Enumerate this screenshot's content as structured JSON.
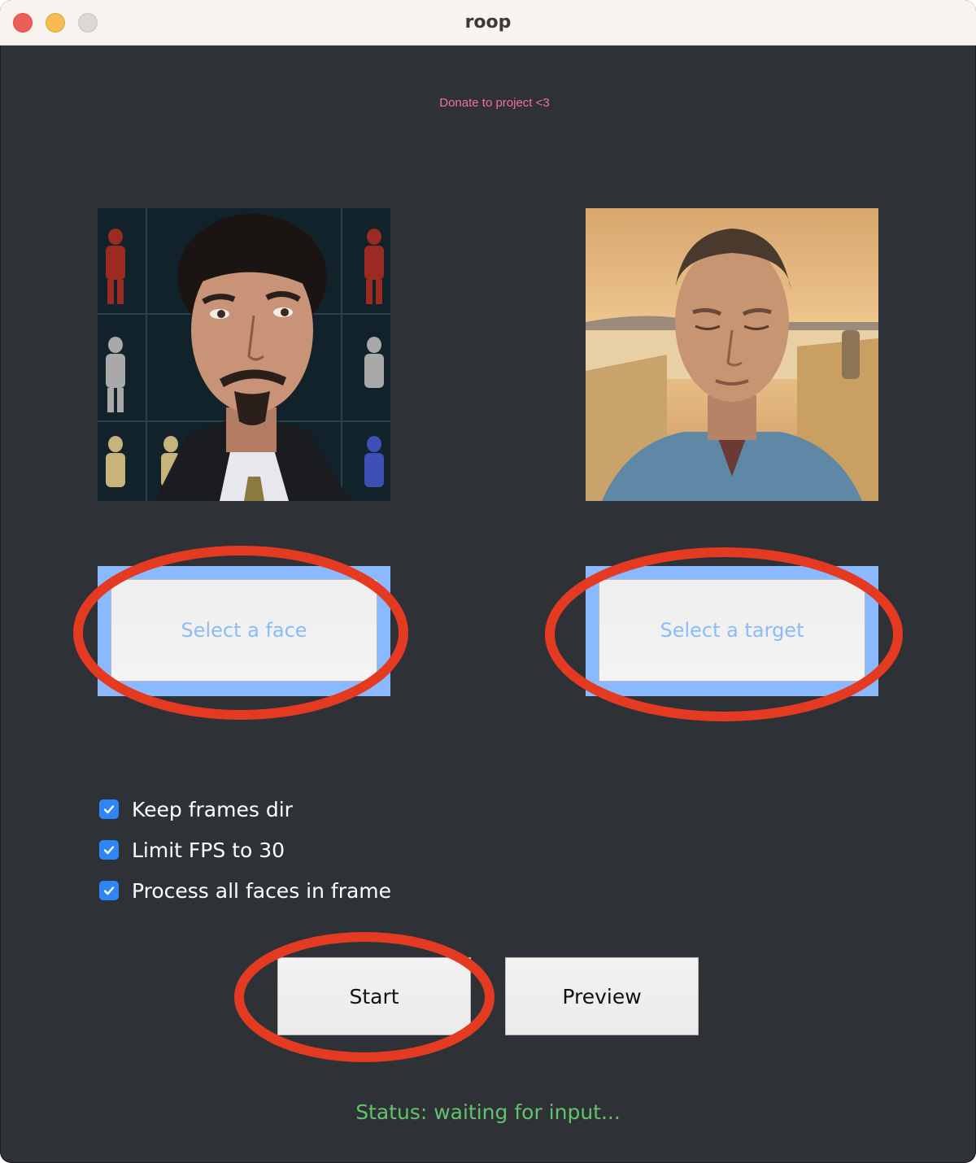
{
  "window": {
    "title": "roop"
  },
  "header": {
    "donate_link": "Donate to project <3"
  },
  "source_panel": {
    "button_label": "Select a face",
    "preview_image": "man-with-goatee-portrait"
  },
  "target_panel": {
    "button_label": "Select a target",
    "preview_image": "man-eyes-closed-sunset"
  },
  "options": [
    {
      "label": "Keep frames dir",
      "checked": true
    },
    {
      "label": "Limit FPS to 30",
      "checked": true
    },
    {
      "label": "Process all faces in frame",
      "checked": true
    }
  ],
  "actions": {
    "start_label": "Start",
    "preview_label": "Preview"
  },
  "status": {
    "text": "Status: waiting for input..."
  },
  "colors": {
    "background": "#2e3236",
    "button_frame": "#8ab9ff",
    "select_text": "#8cbcf7",
    "donate": "#f26ea7",
    "status": "#64c26c",
    "checkbox": "#2e86f6",
    "annotation": "#e43a22"
  }
}
